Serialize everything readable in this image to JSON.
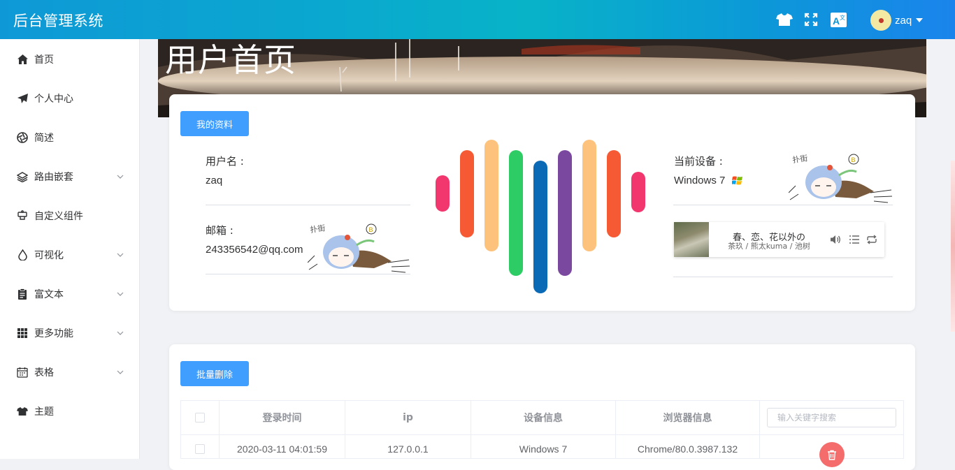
{
  "header": {
    "title": "后台管理系统",
    "user_name": "zaq",
    "icons": [
      "tshirt-icon",
      "fullscreen-icon",
      "translate-icon"
    ]
  },
  "sidebar": {
    "items": [
      {
        "label": "首页",
        "icon": "home-icon",
        "has_children": false
      },
      {
        "label": "个人中心",
        "icon": "paper-plane-icon",
        "has_children": false
      },
      {
        "label": "简述",
        "icon": "aperture-icon",
        "has_children": false
      },
      {
        "label": "路由嵌套",
        "icon": "layers-icon",
        "has_children": true
      },
      {
        "label": "自定义组件",
        "icon": "component-icon",
        "has_children": false
      },
      {
        "label": "可视化",
        "icon": "drop-icon",
        "has_children": true
      },
      {
        "label": "富文本",
        "icon": "clipboard-icon",
        "has_children": true
      },
      {
        "label": "更多功能",
        "icon": "grid-icon",
        "has_children": true
      },
      {
        "label": "表格",
        "icon": "calendar-icon",
        "has_children": true
      },
      {
        "label": "主题",
        "icon": "tshirt-icon",
        "has_children": false
      }
    ]
  },
  "banner": {
    "title": "用户首页"
  },
  "profile": {
    "button_label": "我的资料",
    "username_label": "用户名 :",
    "username_value": "zaq",
    "email_label": "邮箱 :",
    "email_value": "243356542@qq.com",
    "device_label": "当前设备 :",
    "device_value": "Windows 7",
    "chibi_text": "扑街"
  },
  "equalizer": {
    "colors": [
      "#f2376f",
      "#f55a34",
      "#fdc37d",
      "#2ecc64",
      "#0a6ab5",
      "#7b48a0",
      "#fdc37d",
      "#f55a34",
      "#f2376f"
    ]
  },
  "player": {
    "song_title": "春、恋、花以外の",
    "artist": "茶玖 / 熊太kuma / 池树"
  },
  "table": {
    "batch_delete_label": "批量删除",
    "search_placeholder": "输入关键字搜索",
    "columns": [
      "登录时间",
      "ip",
      "设备信息",
      "浏览器信息"
    ],
    "rows": [
      {
        "time": "2020-03-11 04:01:59",
        "ip": "127.0.0.1",
        "device": "Windows 7",
        "browser": "Chrome/80.0.3987.132"
      }
    ]
  }
}
